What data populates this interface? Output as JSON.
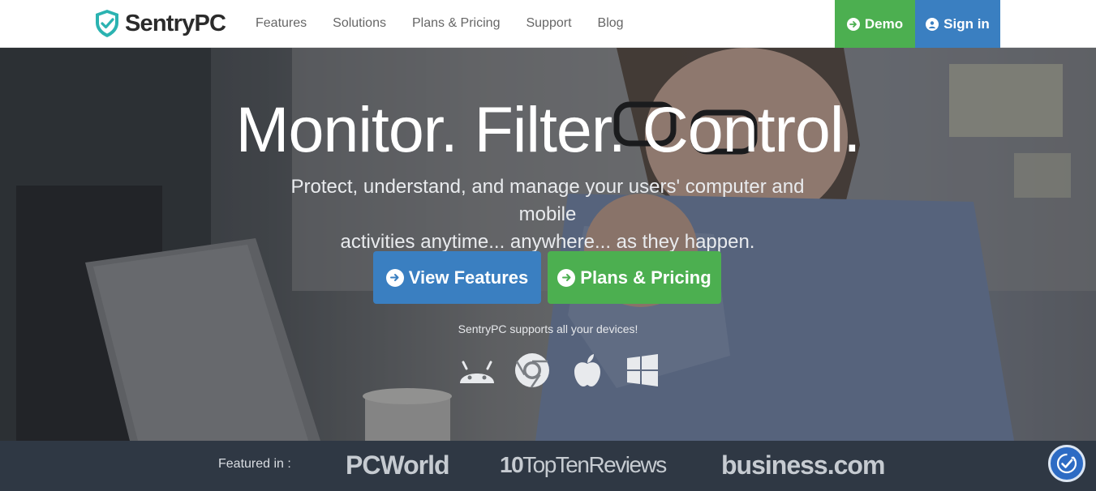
{
  "nav": {
    "brand": "SentryPC",
    "links": [
      "Features",
      "Solutions",
      "Plans & Pricing",
      "Support",
      "Blog"
    ],
    "demo_label": "Demo",
    "signin_label": "Sign in"
  },
  "hero": {
    "title": "Monitor. Filter. Control.",
    "subtitle_line1": "Protect, understand, and manage your users' computer and mobile",
    "subtitle_line2": "activities anytime... anywhere... as they happen.",
    "view_features_label": "View Features",
    "plans_pricing_label": "Plans & Pricing",
    "devices_text": "SentryPC supports all your devices!",
    "device_icons": [
      "android-icon",
      "chrome-icon",
      "apple-icon",
      "windows-icon"
    ]
  },
  "featured": {
    "label": "Featured in :",
    "brands": [
      "PCWorld",
      "TopTenReviews",
      "business.com"
    ],
    "ttr_prefix": "10"
  },
  "colors": {
    "green": "#4caf50",
    "blue": "#3a7fc1",
    "footer_bg": "#2f3844"
  }
}
